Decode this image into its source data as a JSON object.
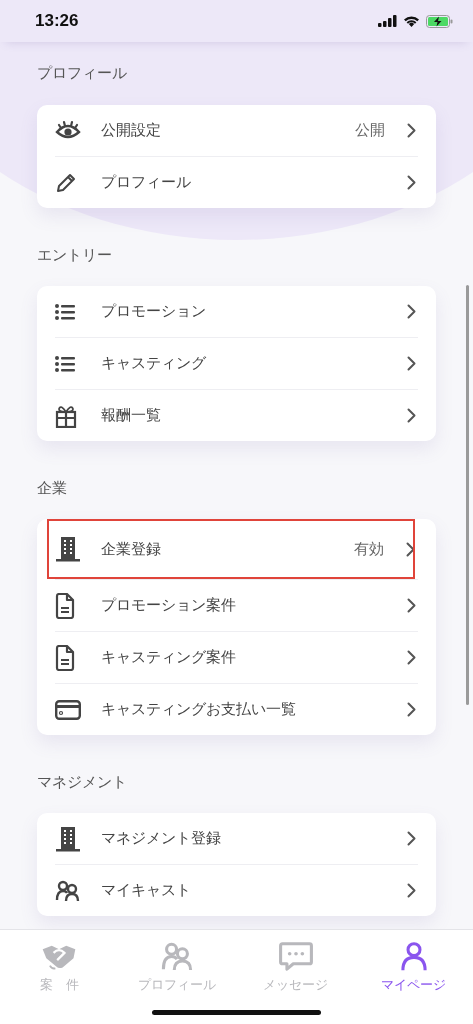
{
  "status_bar": {
    "time": "13:26"
  },
  "sections": [
    {
      "title": "プロフィール",
      "items": [
        {
          "label": "公開設定",
          "value": "公開",
          "highlighted": false
        },
        {
          "label": "プロフィール",
          "highlighted": false
        }
      ]
    },
    {
      "title": "エントリー",
      "items": [
        {
          "label": "プロモーション",
          "highlighted": false
        },
        {
          "label": "キャスティング",
          "highlighted": false
        },
        {
          "label": "報酬一覧",
          "highlighted": false
        }
      ]
    },
    {
      "title": "企業",
      "items": [
        {
          "label": "企業登録",
          "value": "有効",
          "highlighted": true
        },
        {
          "label": "プロモーション案件",
          "highlighted": false
        },
        {
          "label": "キャスティング案件",
          "highlighted": false
        },
        {
          "label": "キャスティングお支払い一覧",
          "highlighted": false
        }
      ]
    },
    {
      "title": "マネジメント",
      "items": [
        {
          "label": "マネジメント登録",
          "highlighted": false
        },
        {
          "label": "マイキャスト",
          "highlighted": false
        }
      ]
    }
  ],
  "tab_bar": [
    {
      "label": "案　件",
      "selected": false
    },
    {
      "label": "プロフィール",
      "selected": false
    },
    {
      "label": "メッセージ",
      "selected": false
    },
    {
      "label": "マイページ",
      "selected": true
    }
  ]
}
